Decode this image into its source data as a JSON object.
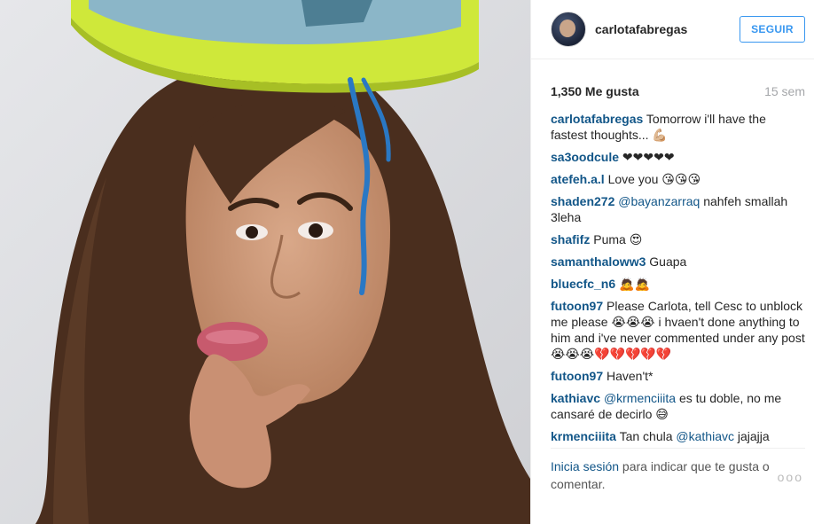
{
  "header": {
    "username": "carlotafabregas",
    "follow_label": "SEGUIR"
  },
  "stats": {
    "likes": "1,350 Me gusta",
    "time": "15 sem"
  },
  "comments": [
    {
      "user": "carlotafabregas",
      "parts": [
        " Tomorrow i'll have the fastest thoughts... 💪🏼"
      ]
    },
    {
      "user": "sa3oodcule",
      "parts": [
        " ❤❤❤❤❤"
      ]
    },
    {
      "user": "atefeh.a.l",
      "parts": [
        " Love you 😘😘😘"
      ]
    },
    {
      "user": "shaden272",
      "mention": "@bayanzarraq",
      "parts": [
        " nahfeh smallah 3leha"
      ]
    },
    {
      "user": "shafifz",
      "parts": [
        " Puma 😍"
      ]
    },
    {
      "user": "samanthaloww3",
      "parts": [
        " Guapa"
      ]
    },
    {
      "user": "bluecfc_n6",
      "parts": [
        " 🙇🙇"
      ]
    },
    {
      "user": "futoon97",
      "parts": [
        " Please Carlota, tell Cesc to unblock me please 😭😭😭 i hvaen't done anything to him and i've never commented under any post 😭😭😭💔💔💔💔💔"
      ]
    },
    {
      "user": "futoon97",
      "parts": [
        " Haven't*"
      ]
    },
    {
      "user": "kathiavc",
      "mention": "@krmenciiita",
      "parts": [
        " es tu doble, no me cansaré de decirlo 😅"
      ]
    },
    {
      "user": "krmenciiita",
      "mention_after": "@kathiavc",
      "parts": [
        " Tan chula ",
        " jajajja"
      ]
    }
  ],
  "footer": {
    "login_link": "Inicia sesión",
    "rest": " para indicar que te gusta o comentar.",
    "more": "ooo"
  },
  "icons": {
    "avatar": "profile-avatar",
    "more": "more-options-icon"
  }
}
